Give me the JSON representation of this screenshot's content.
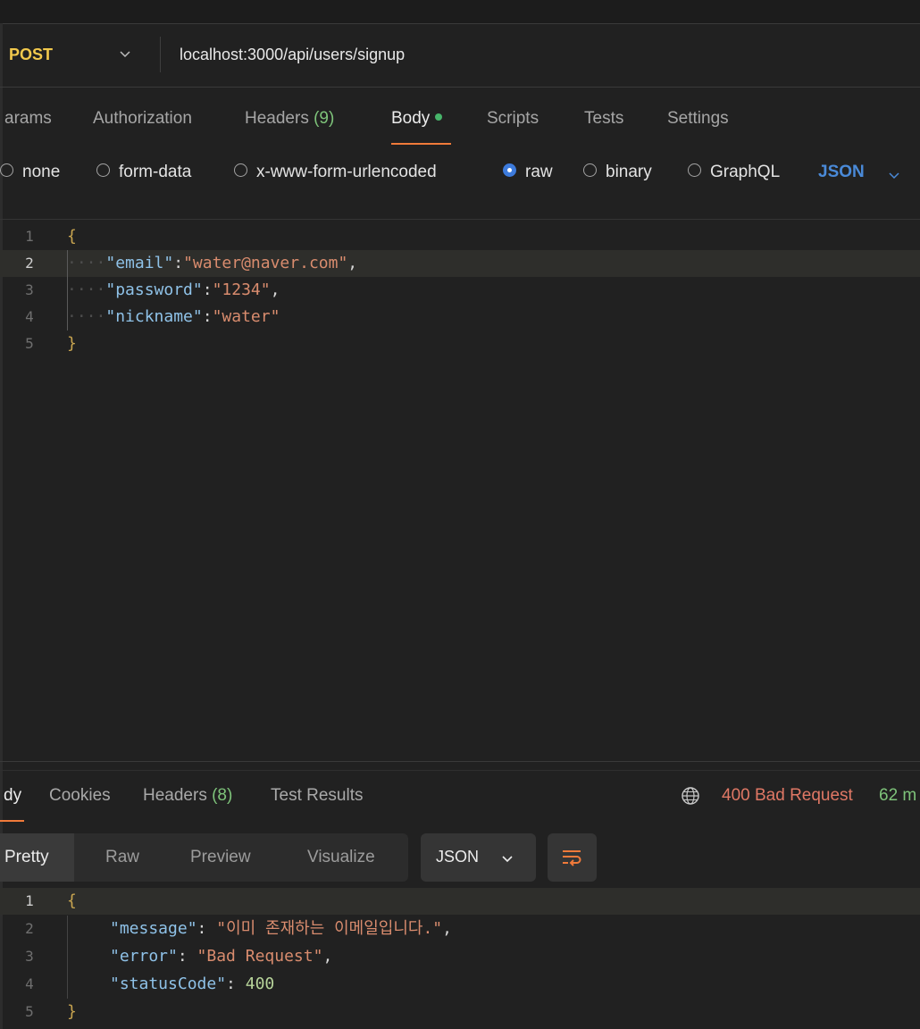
{
  "request": {
    "method": "POST",
    "url": "localhost:3000/api/users/signup"
  },
  "request_tabs": [
    {
      "label": "arams",
      "count": ""
    },
    {
      "label": "Authorization",
      "count": ""
    },
    {
      "label": "Headers",
      "count": "(9)"
    },
    {
      "label": "Body",
      "count": "",
      "active": true,
      "dot": true
    },
    {
      "label": "Scripts",
      "count": ""
    },
    {
      "label": "Tests",
      "count": ""
    },
    {
      "label": "Settings",
      "count": ""
    }
  ],
  "body_types": [
    {
      "label": "none",
      "selected": false
    },
    {
      "label": "form-data",
      "selected": false
    },
    {
      "label": "x-www-form-urlencoded",
      "selected": false
    },
    {
      "label": "raw",
      "selected": true
    },
    {
      "label": "binary",
      "selected": false
    },
    {
      "label": "GraphQL",
      "selected": false
    }
  ],
  "body_format": "JSON",
  "request_body": {
    "line_numbers": [
      "1",
      "2",
      "3",
      "4",
      "5"
    ],
    "open_brace": "{",
    "close_brace": "}",
    "fields": [
      {
        "key": "\"email\"",
        "value": "\"water@naver.com\"",
        "trail": ","
      },
      {
        "key": "\"password\"",
        "value": "\"1234\"",
        "trail": ","
      },
      {
        "key": "\"nickname\"",
        "value": "\"water\"",
        "trail": ""
      }
    ]
  },
  "response": {
    "tabs": [
      {
        "label": "dy",
        "count": "",
        "active": true
      },
      {
        "label": "Cookies",
        "count": ""
      },
      {
        "label": "Headers",
        "count": "(8)"
      },
      {
        "label": "Test Results",
        "count": ""
      }
    ],
    "status": "400 Bad Request",
    "time": "62 m",
    "views": [
      "Pretty",
      "Raw",
      "Preview",
      "Visualize"
    ],
    "format": "JSON",
    "line_numbers": [
      "1",
      "2",
      "3",
      "4",
      "5"
    ],
    "open_brace": "{",
    "close_brace": "}",
    "fields": [
      {
        "key": "\"message\"",
        "value": "\"이미 존재하는 이메일입니다.\"",
        "trail": ",",
        "kind": "string"
      },
      {
        "key": "\"error\"",
        "value": "\"Bad Request\"",
        "trail": ",",
        "kind": "string"
      },
      {
        "key": "\"statusCode\"",
        "value": "400",
        "trail": "",
        "kind": "number"
      }
    ]
  },
  "colors": {
    "method": "#f2c94c",
    "active_tab_underline": "#f07a3a",
    "status_error": "#e07865",
    "time": "#7ec37a",
    "radio_selected": "#3d7bdc"
  }
}
